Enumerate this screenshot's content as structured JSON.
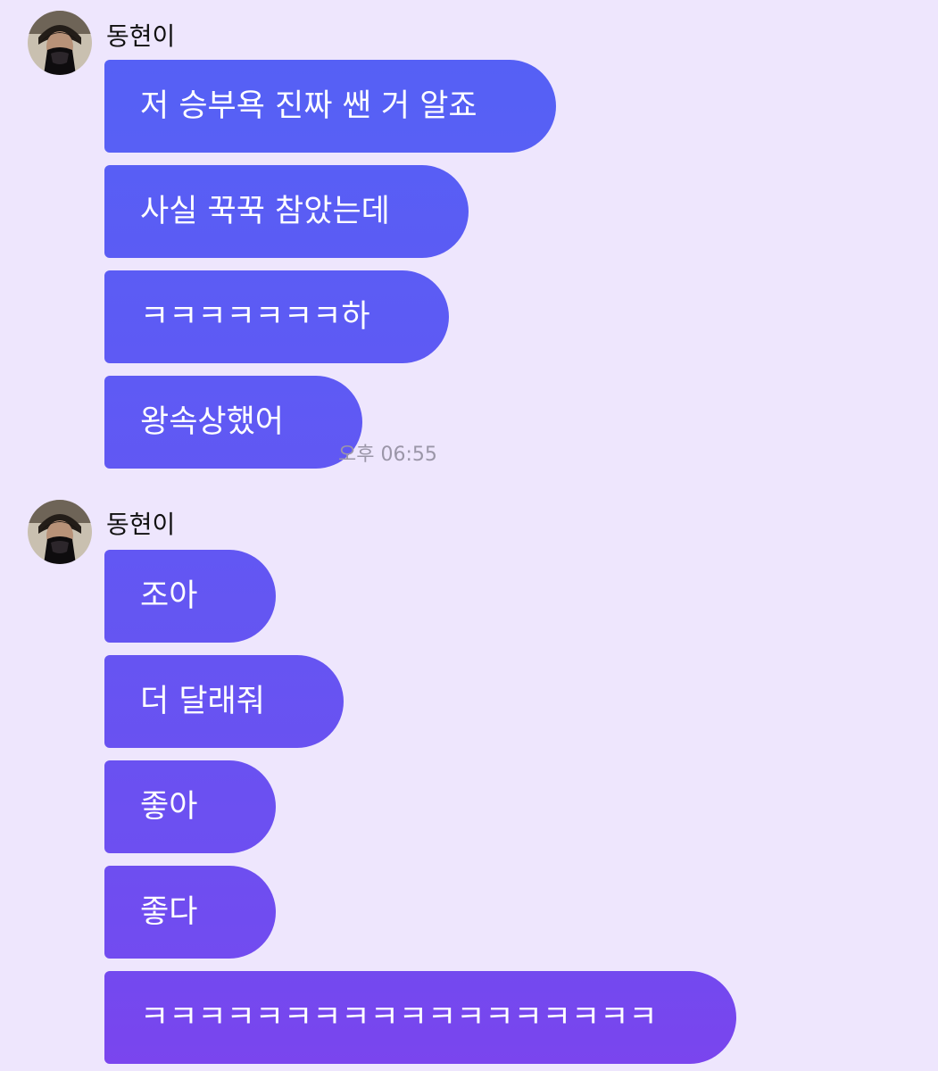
{
  "conversation": {
    "groups": [
      {
        "sender": "동현이",
        "messages": [
          "저 승부욕 진짜 쌘 거 알죠",
          "사실 꾹꾹 참았는데",
          "ㅋㅋㅋㅋㅋㅋㅋ하",
          "왕속상했어"
        ],
        "time": "오후 06:55"
      },
      {
        "sender": "동현이",
        "messages": [
          "조아",
          "더 달래줘",
          "좋아",
          "좋다",
          "ㅋㅋㅋㅋㅋㅋㅋㅋㅋㅋㅋㅋㅋㅋㅋㅋㅋㅋ"
        ]
      }
    ]
  },
  "colors": {
    "background": "#eee6fd",
    "bubble_gradient_start": "#5560f5",
    "bubble_gradient_end": "#7a45ee",
    "sender_name": "#111111",
    "timestamp": "#9b96a8"
  },
  "icons": {
    "avatar": "profile-photo"
  }
}
